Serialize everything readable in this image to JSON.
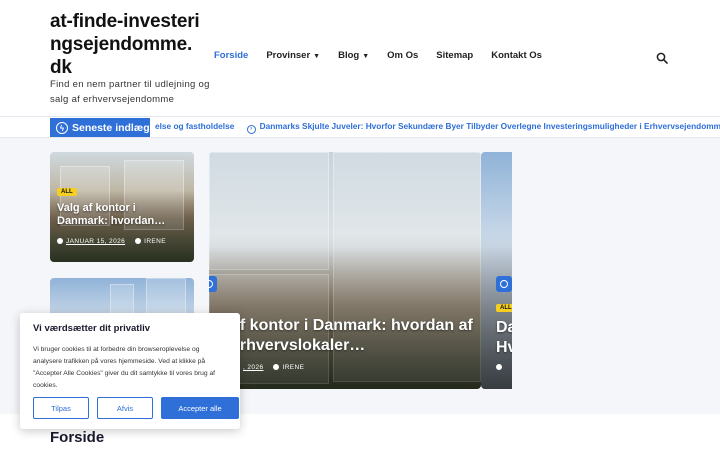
{
  "site": {
    "title": "at-finde-investeringsejendomme.dk",
    "tagline": "Find en nem partner til udlejning og salg af erhvervsejendomme"
  },
  "nav": {
    "items": [
      {
        "label": "Forside",
        "active": true,
        "dropdown": false
      },
      {
        "label": "Provinser",
        "active": false,
        "dropdown": true
      },
      {
        "label": "Blog",
        "active": false,
        "dropdown": true
      },
      {
        "label": "Om Os",
        "active": false,
        "dropdown": false
      },
      {
        "label": "Sitemap",
        "active": false,
        "dropdown": false
      },
      {
        "label": "Kontakt Os",
        "active": false,
        "dropdown": false
      }
    ],
    "search_icon": "search-icon"
  },
  "ticker": {
    "label": "Seneste indlæg",
    "items": [
      "else og fastholdelse",
      "Danmarks Skjulte Juveler: Hvorfor Sekundære Byer Tilbyder Overlegne Investeringsmuligheder i Erhvervsejendomme"
    ]
  },
  "cards": {
    "small1": {
      "badge": "ALL",
      "title": "Valg af kontor i Danmark: hvordan…",
      "date": "JANUAR 15, 2026",
      "author": "IRENE"
    },
    "featured": {
      "title": "af kontor i Danmark: hvordan af erhvervslokaler…",
      "date": ", 2026",
      "author": "IRENE"
    },
    "right": {
      "badge": "ALL",
      "title": "Da Hv"
    }
  },
  "cookie": {
    "title": "Vi værdsætter dit privatliv",
    "text": "Vi bruger cookies til at forbedre din browseroplevelse og analysere trafikken på vores hjemmeside. Ved at klikke på \"Accepter Alle Cookies\" giver du dit samtykke til vores brug af cookies.",
    "customize": "Tilpas",
    "reject": "Afvis",
    "accept": "Accepter alle"
  },
  "page": {
    "heading": "Forside"
  },
  "colors": {
    "accent": "#2e6fd8",
    "badge": "#f5d020"
  }
}
